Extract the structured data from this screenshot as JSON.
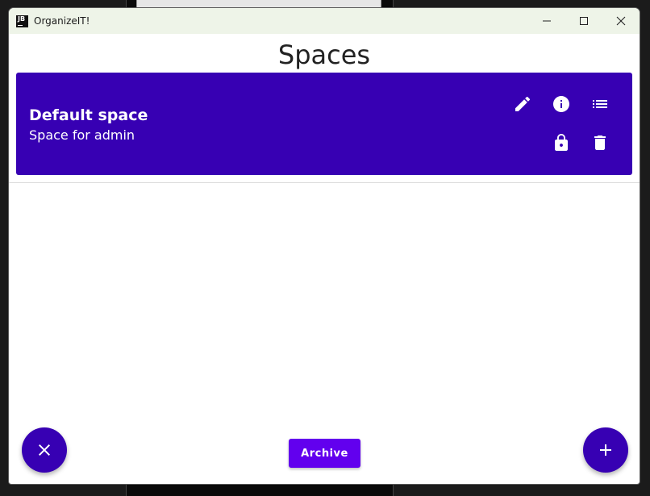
{
  "window": {
    "title": "OrganizeIT!",
    "app_icon_text": "JB"
  },
  "page": {
    "title": "Spaces"
  },
  "spaces": [
    {
      "name": "Default space",
      "description": "Space for admin",
      "actions": [
        "edit-icon",
        "info-icon",
        "list-icon",
        "lock-icon",
        "delete-icon"
      ]
    }
  ],
  "footer": {
    "archive_label": "Archive",
    "left_fab_icon": "close-icon",
    "right_fab_icon": "add-icon"
  },
  "colors": {
    "card": "#3700b3",
    "fab": "#3700b3",
    "archive_button": "#6200ee"
  }
}
